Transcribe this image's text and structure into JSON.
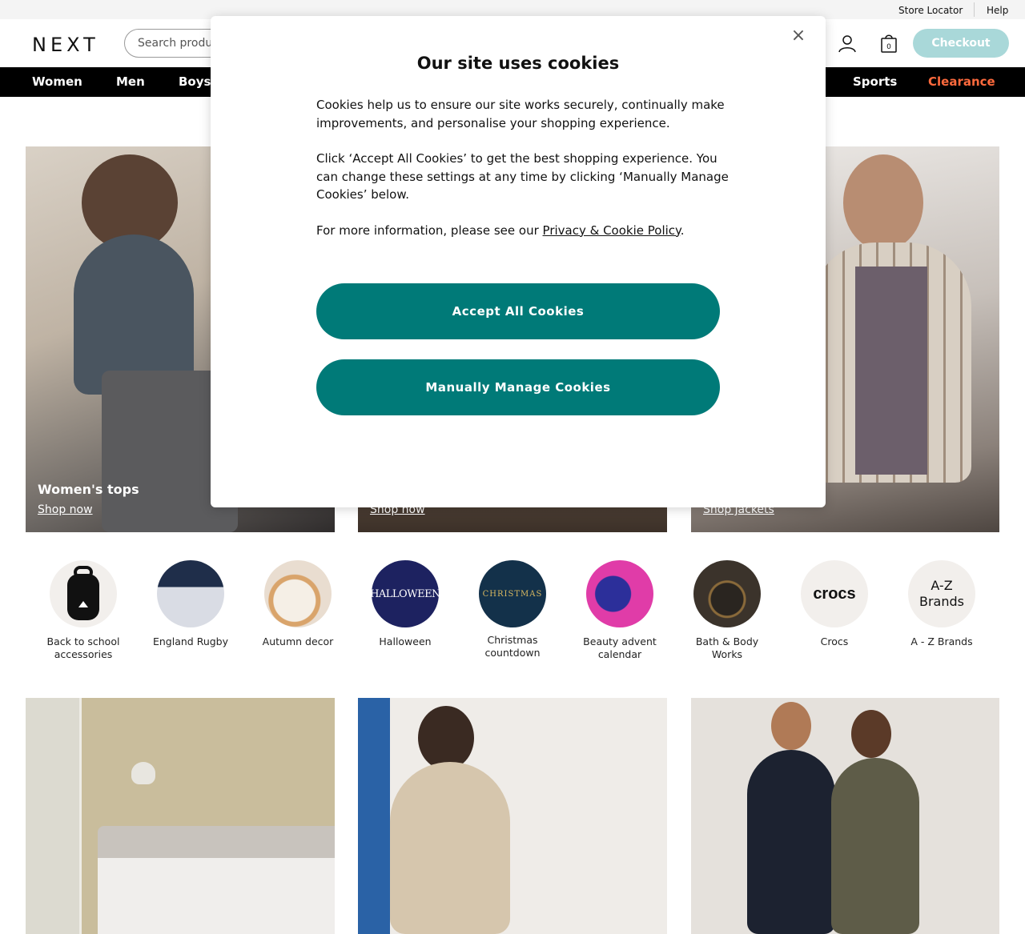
{
  "utility": {
    "store_locator": "Store Locator",
    "help": "Help"
  },
  "header": {
    "logo": "NEXT",
    "search_placeholder": "Search produ",
    "bag_count": "0",
    "checkout": "Checkout"
  },
  "nav": {
    "women": "Women",
    "men": "Men",
    "boys": "Boys",
    "sports": "Sports",
    "clearance": "Clearance",
    "clearance_color": "#ff6a3d"
  },
  "heroes": [
    {
      "title": "Women's tops",
      "link": "Shop now"
    },
    {
      "title": "",
      "link": "Shop now"
    },
    {
      "title": "",
      "link": "Shop jackets"
    }
  ],
  "categories": [
    {
      "label": "Back to school accessories"
    },
    {
      "label": "England Rugby"
    },
    {
      "label": "Autumn decor"
    },
    {
      "label": "Halloween",
      "circle_text": "HALLOWEEN"
    },
    {
      "label": "Christmas countdown",
      "circle_text": "CHRISTMAS"
    },
    {
      "label": "Beauty advent calendar"
    },
    {
      "label": "Bath & Body Works"
    },
    {
      "label": "Crocs",
      "circle_text": "crocs"
    },
    {
      "label": "A - Z Brands",
      "circle_text_1": "A-Z",
      "circle_text_2": "Brands"
    }
  ],
  "cookie_modal": {
    "title": "Our site uses cookies",
    "para1": "Cookies help us to ensure our site works securely, continually make improvements, and personalise your shopping experience.",
    "para2": "Click ‘Accept All Cookies’ to get the best shopping experience. You can change these settings at any time by clicking ‘Manually Manage Cookies’ below.",
    "para3_prefix": "For more information, please see our ",
    "para3_link": "Privacy & Cookie Policy",
    "para3_suffix": ".",
    "accept": "Accept All Cookies",
    "manage": "Manually Manage Cookies",
    "close": "×",
    "button_color": "#007a78"
  }
}
